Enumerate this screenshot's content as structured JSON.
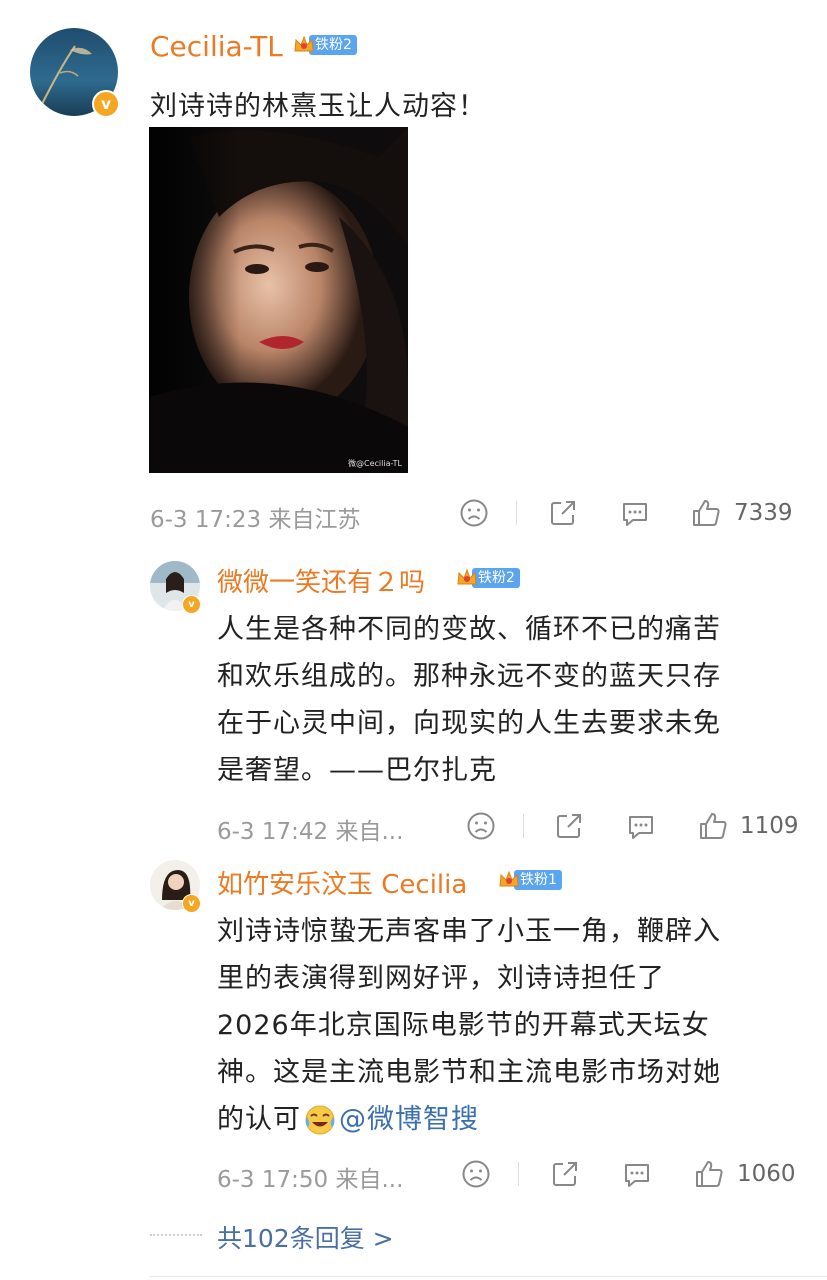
{
  "post": {
    "author": "Cecilia-TL",
    "fan_level": "铁粉2",
    "verified_mark": "v",
    "text": "刘诗诗的林熹玉让人动容！",
    "image_watermark": "微@Cecilia-TL",
    "meta": "6-3 17:23 来自江苏",
    "like_count": "7339"
  },
  "replies": [
    {
      "author": "微微一笑还有２吗",
      "fan_level": "铁粉2",
      "verified_mark": "v",
      "lines": [
        "人生是各种不同的变故、循环不已的痛苦",
        "和欢乐组成的。那种永远不变的蓝天只存",
        "在于心灵中间，向现实的人生去要求未免",
        "是奢望。——巴尔扎克"
      ],
      "meta": "6-3 17:42 来自...",
      "like_count": "1109"
    },
    {
      "author": "如竹安乐汶玉 Cecilia",
      "fan_level": "铁粉1",
      "verified_mark": "v",
      "lines": [
        "刘诗诗惊蛰无声客串了小玉一角，鞭辟入",
        "里的表演得到网好评，刘诗诗担任了",
        "2026年北京国际电影节的开幕式天坛女",
        "神。这是主流电影节和主流电影市场对她"
      ],
      "last_line_prefix": "的认可",
      "mention": "@微博智搜",
      "meta": "6-3 17:50 来自...",
      "like_count": "1060"
    }
  ],
  "more_replies": "共102条回复 >",
  "icons": {
    "dislike": "frown-icon",
    "repost": "share-icon",
    "comment": "comment-icon",
    "like": "thumbs-up-icon",
    "crown": "crown-icon",
    "emoji": "crying-laughing-emoji"
  },
  "colors": {
    "username": "#eb7a23",
    "fan_badge": "#5aa4f0",
    "verified": "#f5a623",
    "link": "#4a6fa5"
  }
}
